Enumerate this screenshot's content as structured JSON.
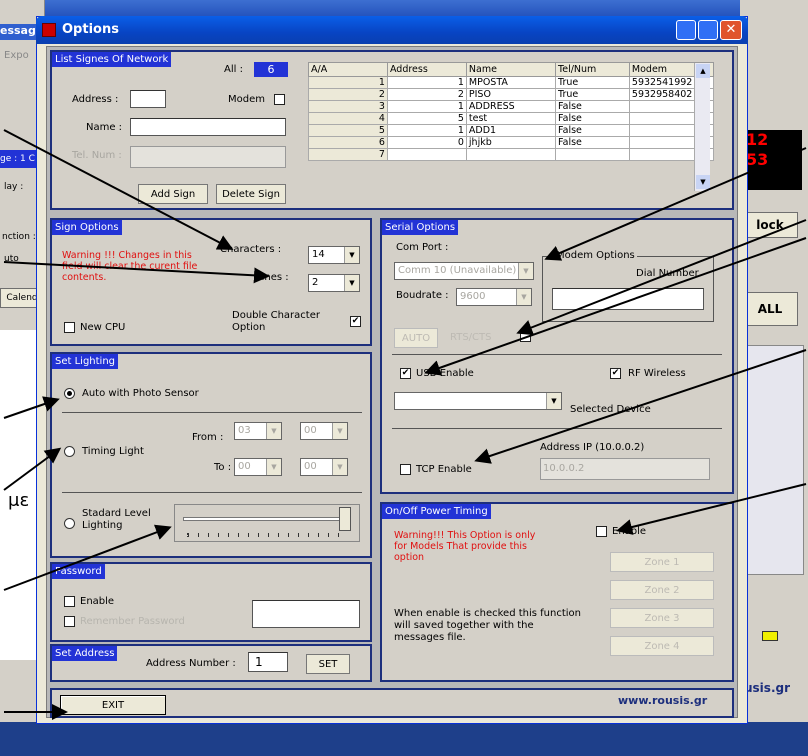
{
  "window": {
    "title": "Options"
  },
  "network": {
    "title": "List Signes Of Network",
    "all_label": "All :",
    "all_count": "6",
    "address_label": "Address :",
    "modem_label": "Modem",
    "name_label": "Name :",
    "tel_label": "Tel. Num :",
    "add_button": "Add Sign",
    "delete_button": "Delete Sign",
    "table": {
      "columns": [
        "A/A",
        "Address",
        "Name",
        "Tel/Num",
        "Modem"
      ],
      "rows": [
        [
          "1",
          "1",
          "MPOSTA",
          "True",
          "5932541992"
        ],
        [
          "2",
          "2",
          "PISO",
          "True",
          "5932958402"
        ],
        [
          "3",
          "1",
          "ADDRESS",
          "False",
          ""
        ],
        [
          "4",
          "5",
          "test",
          "False",
          ""
        ],
        [
          "5",
          "1",
          "ADD1",
          "False",
          ""
        ],
        [
          "6",
          "0",
          "jhjkb",
          "False",
          ""
        ],
        [
          "7",
          "",
          "",
          "",
          ""
        ]
      ]
    }
  },
  "sign_options": {
    "title": "Sign Options",
    "warning": "Warning !!! Changes in this field will clear the curent file contents.",
    "characters_label": "Characters :",
    "characters_value": "14",
    "lines_label": "Lines :",
    "lines_value": "2",
    "new_cpu_label": "New CPU",
    "double_char_label": "Double Character Option"
  },
  "lighting": {
    "title": "Set Lighting",
    "auto_label": "Auto with Photo Sensor",
    "timing_label": "Timing Light",
    "from_label": "From :",
    "to_label": "To :",
    "from_h": "03",
    "from_m": "00",
    "to_h": "00",
    "to_m": "00",
    "standard_label": "Stadard Level Lighting"
  },
  "password": {
    "title": "Password",
    "enable_label": "Enable",
    "remember_label": "Remember Password"
  },
  "address": {
    "title": "Set Address",
    "label": "Address Number :",
    "value": "1",
    "set_button": "SET"
  },
  "exit_button": "EXIT",
  "serial": {
    "title": "Serial Options",
    "com_port_label": "Com Port :",
    "com_port_value": "Comm 10 (Unavailable)",
    "modem_options_label": "Modem Options",
    "dial_number_label": "Dial Number",
    "baudrate_label": "Boudrate :",
    "baudrate_value": "9600",
    "auto_button": "AUTO",
    "rts_label": "RTS/CTS",
    "usb_label": "USB Enable",
    "rf_label": "RF Wireless",
    "selected_device_label": "Selected Device",
    "address_ip_label": "Address IP (10.0.0.2)",
    "tcp_label": "TCP Enable",
    "ip_value": "10.0.0.2"
  },
  "power": {
    "title": "On/Off Power Timing",
    "warning": "Warning!!! This Option is only for Models That provide this option",
    "enable_label": "Enable",
    "info": "When enable is checked this function will saved together with the messages file.",
    "zones": [
      "Zone 1",
      "Zone 2",
      "Zone 3",
      "Zone 4"
    ]
  },
  "footer": {
    "url": "www.rousis.gr"
  },
  "background": {
    "left_fragments": [
      "essag",
      "Expo",
      "ge : 1 C",
      "lay :",
      "nction :",
      "uto",
      "Calend"
    ],
    "right_fragments": [
      "12",
      "53",
      "lock",
      "ALL",
      "usis.gr"
    ],
    "greek_fragment": "με"
  }
}
